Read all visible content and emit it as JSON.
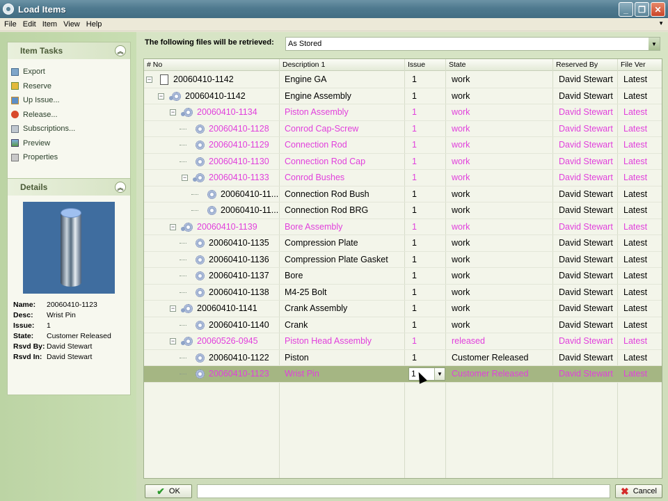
{
  "window": {
    "title": "Load Items",
    "minimize": "_",
    "maximize": "❐",
    "close": "✕"
  },
  "menu": [
    {
      "label": "File"
    },
    {
      "label": "Edit"
    },
    {
      "label": "Item"
    },
    {
      "label": "View"
    },
    {
      "label": "Help"
    }
  ],
  "item_tasks": {
    "title": "Item Tasks",
    "items": [
      {
        "label": "Export",
        "icon": "export-icon"
      },
      {
        "label": "Reserve",
        "icon": "reserve-icon"
      },
      {
        "label": "Up Issue...",
        "icon": "up-issue-icon"
      },
      {
        "label": "Release...",
        "icon": "release-icon"
      },
      {
        "label": "Subscriptions...",
        "icon": "subscriptions-icon"
      },
      {
        "label": "Preview",
        "icon": "preview-icon"
      },
      {
        "label": "Properties",
        "icon": "properties-icon"
      }
    ]
  },
  "details": {
    "title": "Details",
    "fields": [
      {
        "key": "Name:",
        "value": "20060410-1123"
      },
      {
        "key": "Desc:",
        "value": "Wrist Pin"
      },
      {
        "key": "Issue:",
        "value": "1"
      },
      {
        "key": "State:",
        "value": "Customer Released"
      },
      {
        "key": "Rsvd By:",
        "value": "David Stewart"
      },
      {
        "key": "Rsvd In:",
        "value": "David Stewart"
      }
    ]
  },
  "retrieve": {
    "label": "The following files will be retrieved:",
    "value": "As Stored"
  },
  "columns": [
    "# No",
    "Description 1",
    "Issue",
    "State",
    "Reserved By",
    "File Ver"
  ],
  "rows": [
    {
      "no": "20060410-1142",
      "desc": "Engine GA",
      "issue": "1",
      "state": "work",
      "by": "David Stewart",
      "ver": "Latest",
      "level": 0,
      "pink": false
    },
    {
      "no": "20060410-1142",
      "desc": "Engine Assembly",
      "issue": "1",
      "state": "work",
      "by": "David Stewart",
      "ver": "Latest",
      "level": 1,
      "pink": false
    },
    {
      "no": "20060410-1134",
      "desc": "Piston Assembly",
      "issue": "1",
      "state": "work",
      "by": "David Stewart",
      "ver": "Latest",
      "level": 2,
      "pink": true
    },
    {
      "no": "20060410-1128",
      "desc": "Conrod Cap-Screw",
      "issue": "1",
      "state": "work",
      "by": "David Stewart",
      "ver": "Latest",
      "level": 3,
      "pink": true
    },
    {
      "no": "20060410-1129",
      "desc": "Connection Rod",
      "issue": "1",
      "state": "work",
      "by": "David Stewart",
      "ver": "Latest",
      "level": 3,
      "pink": true
    },
    {
      "no": "20060410-1130",
      "desc": "Connection Rod Cap",
      "issue": "1",
      "state": "work",
      "by": "David Stewart",
      "ver": "Latest",
      "level": 3,
      "pink": true
    },
    {
      "no": "20060410-1133",
      "desc": "Conrod Bushes",
      "issue": "1",
      "state": "work",
      "by": "David Stewart",
      "ver": "Latest",
      "level": 3,
      "pink": true
    },
    {
      "no": "20060410-11...",
      "desc": "Connection Rod Bush",
      "issue": "1",
      "state": "work",
      "by": "David Stewart",
      "ver": "Latest",
      "level": 4,
      "pink": false
    },
    {
      "no": "20060410-11...",
      "desc": "Connection Rod BRG",
      "issue": "1",
      "state": "work",
      "by": "David Stewart",
      "ver": "Latest",
      "level": 4,
      "pink": false
    },
    {
      "no": "20060410-1139",
      "desc": "Bore Assembly",
      "issue": "1",
      "state": "work",
      "by": "David Stewart",
      "ver": "Latest",
      "level": 2,
      "pink": true
    },
    {
      "no": "20060410-1135",
      "desc": "Compression Plate",
      "issue": "1",
      "state": "work",
      "by": "David Stewart",
      "ver": "Latest",
      "level": 3,
      "pink": false
    },
    {
      "no": "20060410-1136",
      "desc": "Compression Plate Gasket",
      "issue": "1",
      "state": "work",
      "by": "David Stewart",
      "ver": "Latest",
      "level": 3,
      "pink": false
    },
    {
      "no": "20060410-1137",
      "desc": "Bore",
      "issue": "1",
      "state": "work",
      "by": "David Stewart",
      "ver": "Latest",
      "level": 3,
      "pink": false
    },
    {
      "no": "20060410-1138",
      "desc": "M4-25 Bolt",
      "issue": "1",
      "state": "work",
      "by": "David Stewart",
      "ver": "Latest",
      "level": 3,
      "pink": false
    },
    {
      "no": "20060410-1141",
      "desc": "Crank Assembly",
      "issue": "1",
      "state": "work",
      "by": "David Stewart",
      "ver": "Latest",
      "level": 2,
      "pink": false
    },
    {
      "no": "20060410-1140",
      "desc": "Crank",
      "issue": "1",
      "state": "work",
      "by": "David Stewart",
      "ver": "Latest",
      "level": 3,
      "pink": false
    },
    {
      "no": "20060526-0945",
      "desc": "Piston Head Assembly",
      "issue": "1",
      "state": "released",
      "by": "David Stewart",
      "ver": "Latest",
      "level": 2,
      "pink": true
    },
    {
      "no": "20060410-1122",
      "desc": "Piston",
      "issue": "1",
      "state": "Customer Released",
      "by": "David Stewart",
      "ver": "Latest",
      "level": 3,
      "pink": false
    },
    {
      "no": "20060410-1123",
      "desc": "Wrist Pin",
      "issue": "1",
      "state": "Customer Released",
      "by": "David Stewart",
      "ver": "Latest",
      "level": 3,
      "pink": true,
      "selected": true
    }
  ],
  "buttons": {
    "ok": "OK",
    "cancel": "Cancel"
  },
  "colors": {
    "pink": "#e13fdc",
    "selected_row": "#a5b683"
  }
}
